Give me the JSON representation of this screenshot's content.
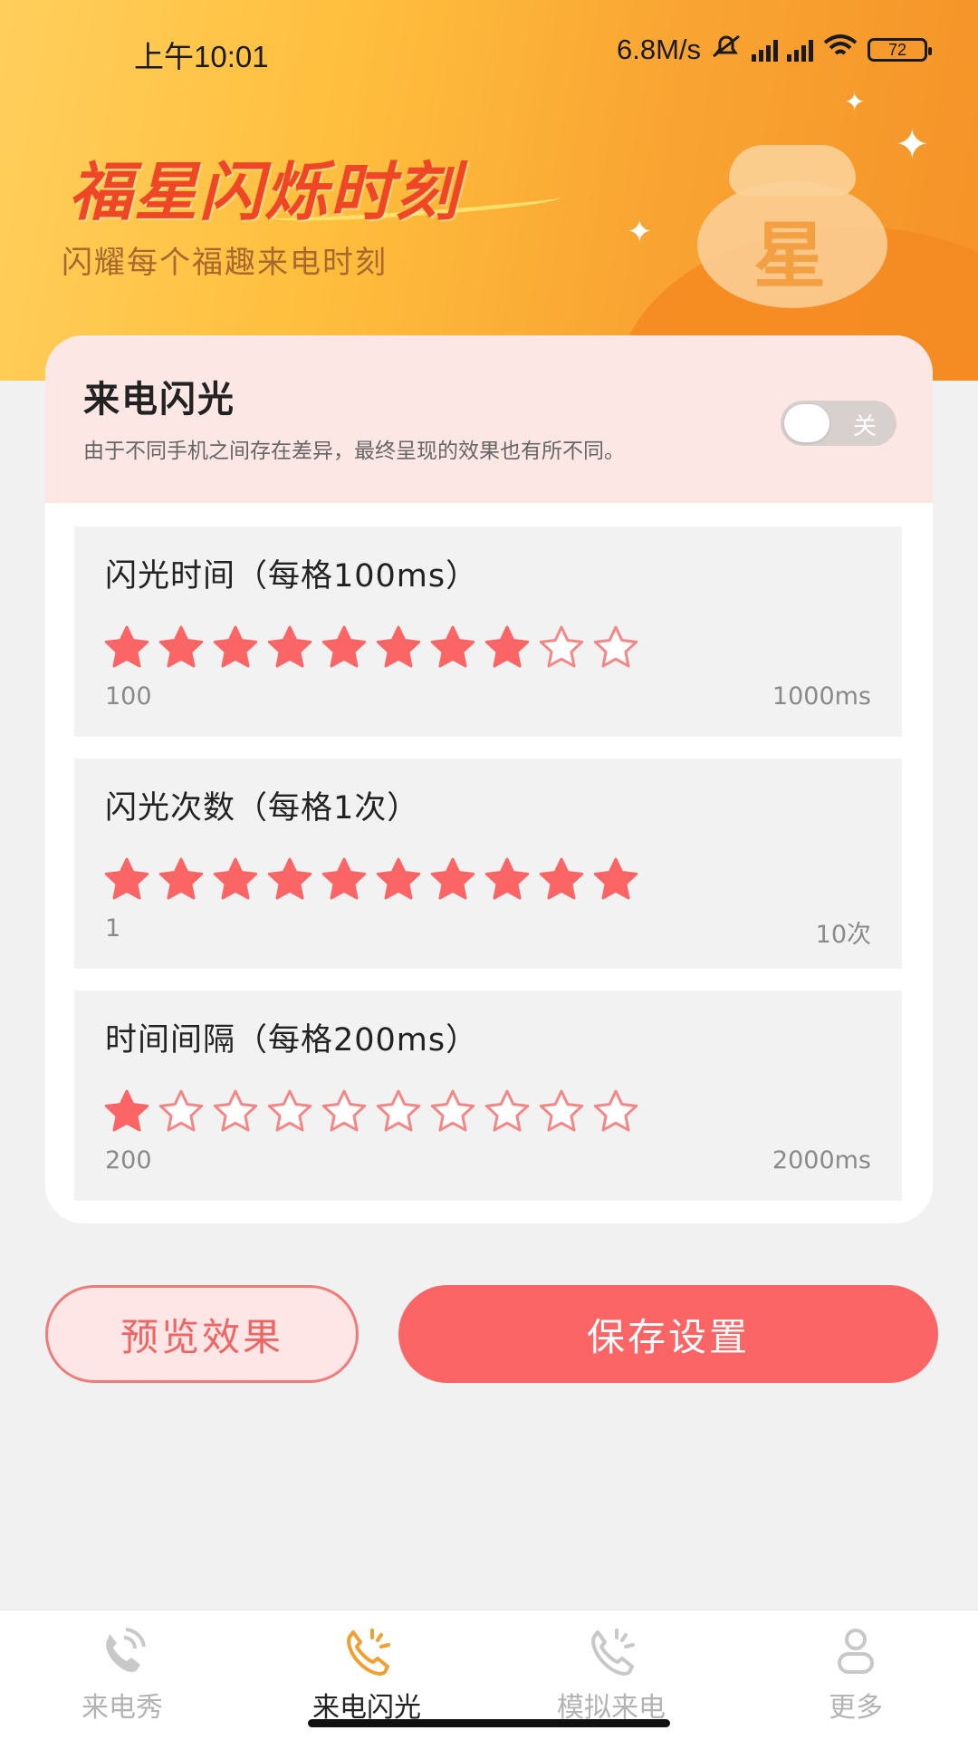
{
  "status_bar": {
    "time": "上午10:01",
    "speed": "6.8M/s",
    "battery": "72"
  },
  "hero": {
    "title": "福星闪烁时刻",
    "subtitle": "闪耀每个福趣来电时刻",
    "bag_char": "星"
  },
  "flash": {
    "title": "来电闪光",
    "description": "由于不同手机之间存在差异，最终呈现的效果也有所不同。",
    "toggle_label": "关",
    "enabled": false
  },
  "settings": [
    {
      "title": "闪光时间（每格100ms）",
      "min": "100",
      "max": "1000ms",
      "value": 8,
      "total": 10
    },
    {
      "title": "闪光次数（每格1次）",
      "min": "1",
      "max": "10次",
      "value": 10,
      "total": 10
    },
    {
      "title": "时间间隔（每格200ms）",
      "min": "200",
      "max": "2000ms",
      "value": 1,
      "total": 10
    }
  ],
  "buttons": {
    "preview": "预览效果",
    "save": "保存设置"
  },
  "tabs": [
    {
      "label": "来电秀",
      "icon": "phone-wave-icon",
      "active": false
    },
    {
      "label": "来电闪光",
      "icon": "phone-flash-icon",
      "active": true
    },
    {
      "label": "模拟来电",
      "icon": "phone-ring-icon",
      "active": false
    },
    {
      "label": "更多",
      "icon": "person-icon",
      "active": false
    }
  ],
  "colors": {
    "accent": "#fb6566",
    "star_fill": "#fb6566",
    "star_outline": "#f48686",
    "hero_title": "#ef4726",
    "tab_active": "#f0a030",
    "tab_inactive": "#c8c8c8"
  }
}
